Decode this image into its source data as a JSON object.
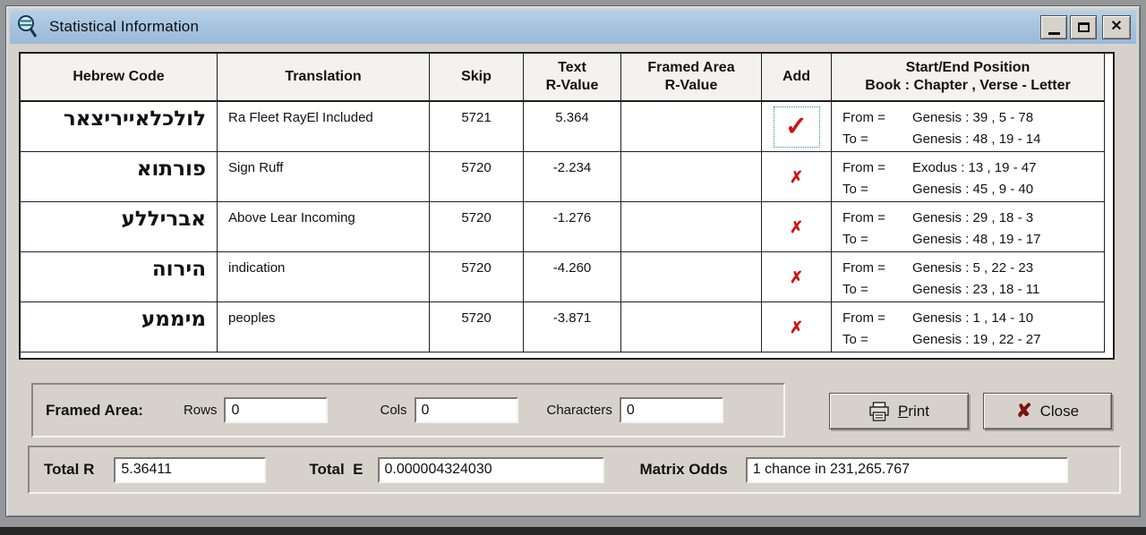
{
  "window": {
    "title": "Statistical Information",
    "close_glyph": "✕"
  },
  "table": {
    "headers": [
      {
        "line1": "Hebrew Code"
      },
      {
        "line1": "Translation"
      },
      {
        "line1": "Skip"
      },
      {
        "line1": "Text",
        "line2": "R-Value"
      },
      {
        "line1": "Framed Area",
        "line2": "R-Value"
      },
      {
        "line1": "Add"
      },
      {
        "line1": "Start/End Position",
        "line2": "Book : Chapter , Verse - Letter"
      }
    ],
    "from_label": "From =",
    "to_label": "To =",
    "rows": [
      {
        "hebrew": "ראצירייאלכלול",
        "translation": "Ra Fleet RayEl Included",
        "skip": "5721",
        "text_r": "5.364",
        "framed_r": "",
        "add": "checked",
        "from": "Genesis : 39 , 5 - 78",
        "to": "Genesis : 48 , 19 - 14"
      },
      {
        "hebrew": "אותרופ",
        "translation": "Sign Ruff",
        "skip": "5720",
        "text_r": "-2.234",
        "framed_r": "",
        "add": "crossed",
        "from": "Exodus : 13 , 19 - 47",
        "to": "Genesis : 45 , 9 - 40"
      },
      {
        "hebrew": "עללירבא",
        "translation": "Above Lear Incoming",
        "skip": "5720",
        "text_r": "-1.276",
        "framed_r": "",
        "add": "crossed",
        "from": "Genesis : 29 , 18 - 3",
        "to": "Genesis : 48 , 19 - 17"
      },
      {
        "hebrew": "הוריה",
        "translation": "indication",
        "skip": "5720",
        "text_r": "-4.260",
        "framed_r": "",
        "add": "crossed",
        "from": "Genesis : 5 , 22 - 23",
        "to": "Genesis : 23 , 18 - 11"
      },
      {
        "hebrew": "עממימ",
        "translation": "peoples",
        "skip": "5720",
        "text_r": "-3.871",
        "framed_r": "",
        "add": "crossed",
        "from": "Genesis : 1 , 14 - 10",
        "to": "Genesis : 19 , 22 - 27"
      }
    ]
  },
  "icons": {
    "check": "✓",
    "cross": "✗",
    "close_button": "✘"
  },
  "framed_area": {
    "label": "Framed Area:",
    "rows_label": "Rows",
    "rows_value": "0",
    "cols_label": "Cols",
    "cols_value": "0",
    "characters_label": "Characters",
    "characters_value": "0"
  },
  "actions": {
    "print_initial": "P",
    "print_rest": "rint",
    "close_label": "Close"
  },
  "totals": {
    "total_r_label": "Total R",
    "total_r_value": "5.36411",
    "total_e_label": "Total  E",
    "total_e_value": "0.000004324030",
    "matrix_odds_label": "Matrix Odds",
    "matrix_odds_value": "1 chance in 231,265.767"
  },
  "colors": {
    "titlebar": "#a9c4de",
    "accent_red": "#cf1414",
    "close_x": "#7d1113",
    "focus_teal": "#2f8f8f"
  }
}
